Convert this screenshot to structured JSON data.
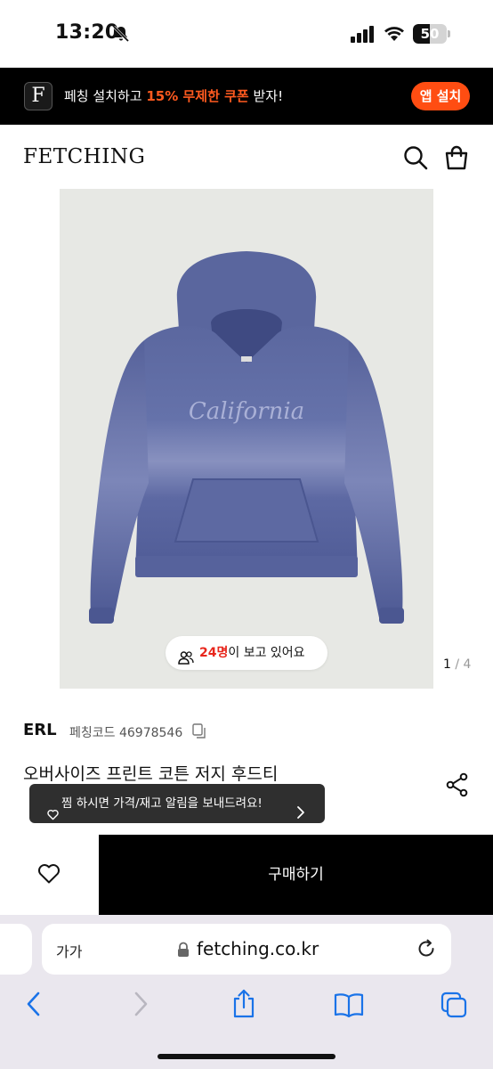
{
  "status_bar": {
    "time": "13:20",
    "battery": "50",
    "battery_level": 0.5
  },
  "promo": {
    "logo_letter": "F",
    "text_prefix": "페칭 설치하고 ",
    "highlight": "15% 무제한 쿠폰",
    "text_suffix": " 받자!",
    "button_label": "앱 설치",
    "accent_color": "#ff4d12"
  },
  "header": {
    "logo": "FETCHING",
    "icons": [
      "search-icon",
      "shopping-bag-icon"
    ]
  },
  "gallery": {
    "image_alt": "hoodie-product-photo",
    "print_text": "California",
    "viewer_count": "24명",
    "viewer_text": "이 보고 있어요",
    "page_current": "1",
    "page_separator": "/",
    "page_total": "4"
  },
  "product": {
    "brand": "ERL",
    "code_label": "페칭코드 46978546",
    "title": "오버사이즈 프린트 코튼 저지 후드티",
    "wish_tooltip": "찜 하시면 가격/재고 알림을 보내드려요!"
  },
  "actions": {
    "buy_label": "구매하기"
  },
  "safari": {
    "aa_label": "가가",
    "url": "fetching.co.kr",
    "toolbar": [
      "back-icon",
      "forward-icon",
      "share-icon",
      "bookmarks-icon",
      "tabs-icon"
    ]
  },
  "colors": {
    "accent": "#ff4d12",
    "viewer_highlight": "#e8261c",
    "ios_blue": "#1a73e8"
  }
}
